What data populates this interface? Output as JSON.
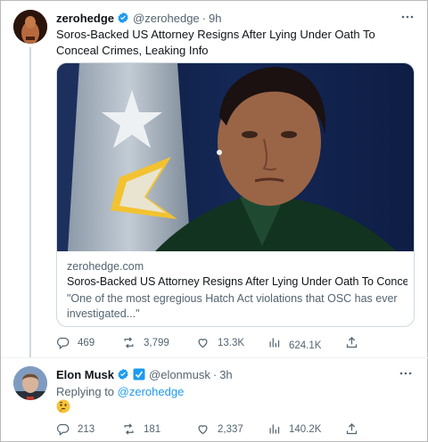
{
  "tweet": {
    "author_name": "zerohedge",
    "author_handle": "@zerohedge",
    "separator": "·",
    "time": "9h",
    "text": "Soros-Backed US Attorney Resigns After Lying Under Oath To Conceal Crimes, Leaking Info",
    "card": {
      "domain": "zerohedge.com",
      "title": "Soros-Backed US Attorney Resigns After Lying Under Oath To Conce...",
      "description": "\"One of the most egregious Hatch Act violations that OSC has ever investigated...\""
    },
    "actions": {
      "replies": "469",
      "retweets": "3,799",
      "likes": "13.3K",
      "views": "624.1K"
    }
  },
  "reply": {
    "author_name": "Elon Musk",
    "author_handle": "@elonmusk",
    "separator": "·",
    "time": "3h",
    "replying_prefix": "Replying to",
    "replying_to": "@zerohedge",
    "emoji": "thinking-face-icon",
    "actions": {
      "replies": "213",
      "retweets": "181",
      "likes": "2,337",
      "views": "140.2K"
    }
  },
  "colors": {
    "accent": "#1d9bf0",
    "secondary_text": "#536471",
    "gov_badge": "#829aab"
  }
}
